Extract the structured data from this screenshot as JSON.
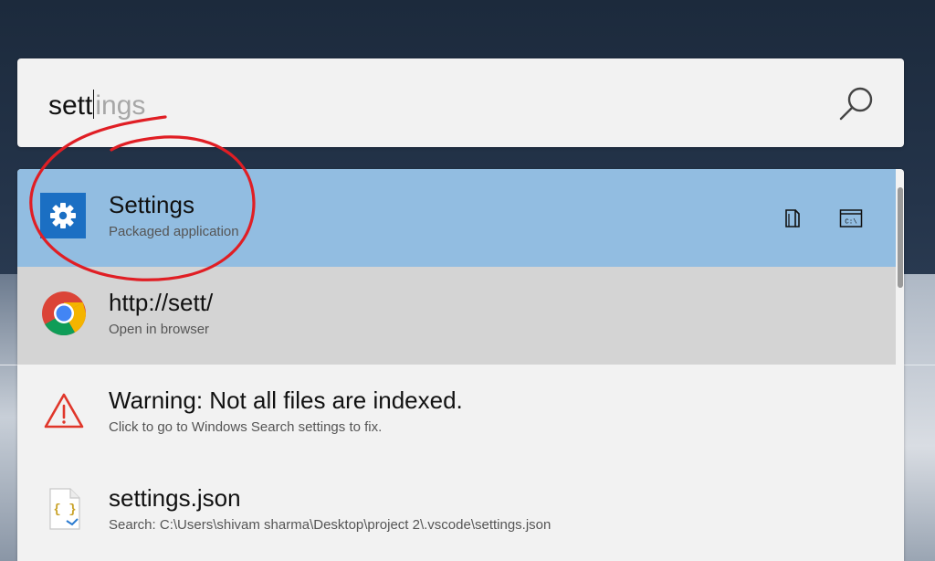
{
  "search": {
    "typed": "sett",
    "suggestion": "ings"
  },
  "results": [
    {
      "title": "Settings",
      "subtitle": "Packaged application",
      "icon": "gear-icon",
      "state": "selected"
    },
    {
      "title": "http://sett/",
      "subtitle": "Open in browser",
      "icon": "chrome-icon",
      "state": "hover"
    },
    {
      "title": "Warning: Not all files are indexed.",
      "subtitle": "Click to go to Windows Search settings to fix.",
      "icon": "warning-icon",
      "state": "normal"
    },
    {
      "title": "settings.json",
      "subtitle": "Search: C:\\Users\\shivam sharma\\Desktop\\project 2\\.vscode\\settings.json",
      "icon": "json-file-icon",
      "state": "normal"
    }
  ],
  "row_actions": {
    "open_folder_icon": "open-containing-folder-icon",
    "console_icon": "console-icon",
    "console_glyph": "C:\\"
  },
  "colors": {
    "selected_row": "#92bde1",
    "hover_row": "#d4d4d4",
    "panel": "#f2f2f2",
    "accent_tile": "#1b6fc3",
    "annotation_red": "#e01e24"
  }
}
